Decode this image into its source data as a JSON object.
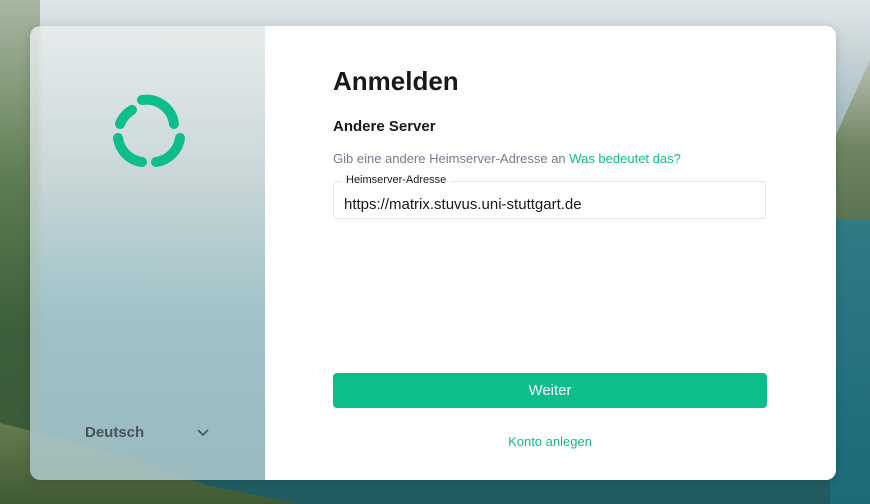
{
  "left": {
    "logo_color": "#0dbd8b",
    "logo_icon": "element-logo-icon",
    "language": "Deutsch",
    "language_chevron": "⌄"
  },
  "auth": {
    "title": "Anmelden",
    "subtitle": "Andere Server",
    "description": "Gib eine andere Heimserver-Adresse an",
    "help_link": "Was bedeutet das?",
    "field_label": "Heimserver-Adresse",
    "field_value": "https://matrix.stuvus.uni-stuttgart.de",
    "continue_button": "Weiter",
    "create_account_link": "Konto anlegen"
  },
  "colors": {
    "accent": "#0dbd8b",
    "text": "#17191c",
    "muted": "#737d8c"
  }
}
